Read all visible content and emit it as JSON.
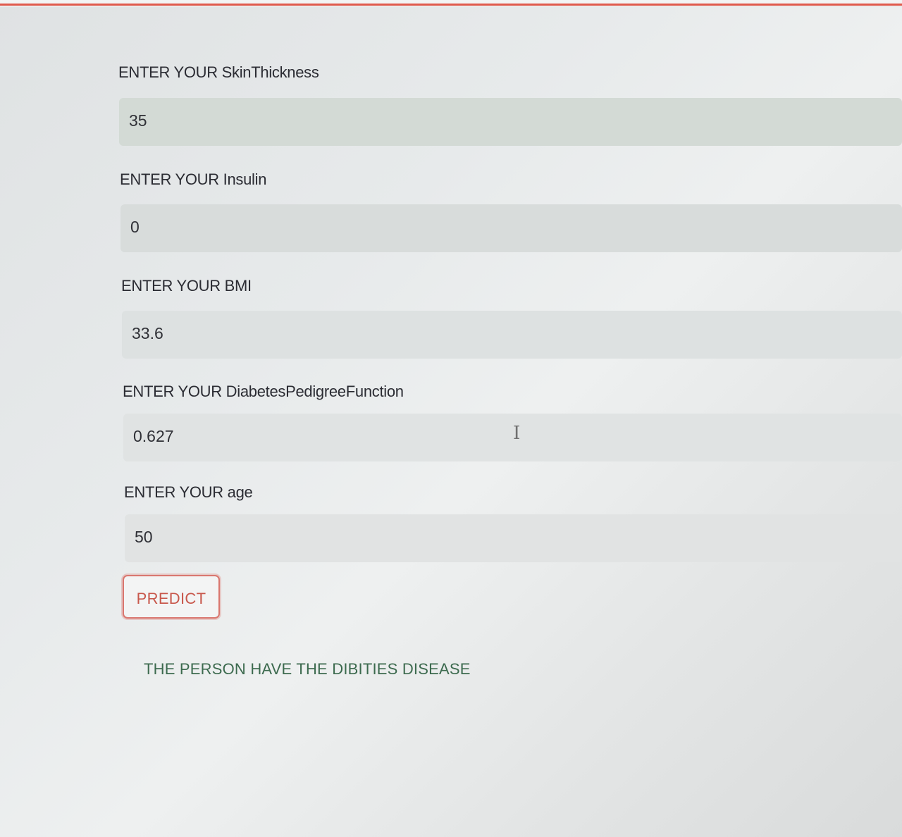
{
  "fields": [
    {
      "label": "ENTER YOUR SkinThickness",
      "value": "35"
    },
    {
      "label": "ENTER YOUR Insulin",
      "value": "0"
    },
    {
      "label": "ENTER YOUR BMI",
      "value": "33.6"
    },
    {
      "label": "ENTER YOUR DiabetesPedigreeFunction",
      "value": "0.627"
    },
    {
      "label": "ENTER YOUR age",
      "value": "50"
    }
  ],
  "predict_button": {
    "label": "PREDICT"
  },
  "result_text": "THE PERSON HAVE THE DIBITIES DISEASE",
  "colors": {
    "accent": "#e05a4c",
    "button_text": "#c8584c",
    "result_text": "#3c6a4e"
  },
  "icons": {
    "cursor": "text-cursor-icon"
  }
}
